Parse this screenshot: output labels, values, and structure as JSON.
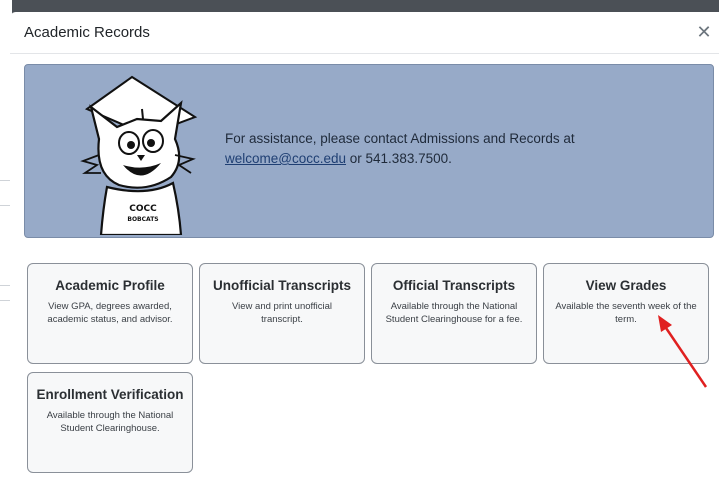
{
  "modal": {
    "title": "Academic Records",
    "close_glyph": "✕"
  },
  "banner": {
    "text_before": "For assistance, please contact Admissions and Records at",
    "email": "welcome@cocc.edu",
    "text_middle": "or 541.383.7500.",
    "mascot_shirt_line1": "COCC",
    "mascot_shirt_line2": "BOBCATS"
  },
  "cards": [
    {
      "title": "Academic Profile",
      "desc": "View GPA, degrees awarded, academic status, and advisor."
    },
    {
      "title": "Unofficial Transcripts",
      "desc": "View and print unofficial transcript."
    },
    {
      "title": "Official Transcripts",
      "desc": "Available through the National Student Clearinghouse for a fee."
    },
    {
      "title": "View Grades",
      "desc": "Available the seventh week of the term."
    },
    {
      "title": "Enrollment Verification",
      "desc": "Available through the National Student Clearinghouse."
    }
  ],
  "annotation": {
    "color": "#e02020",
    "icon": "red-arrow-icon"
  }
}
